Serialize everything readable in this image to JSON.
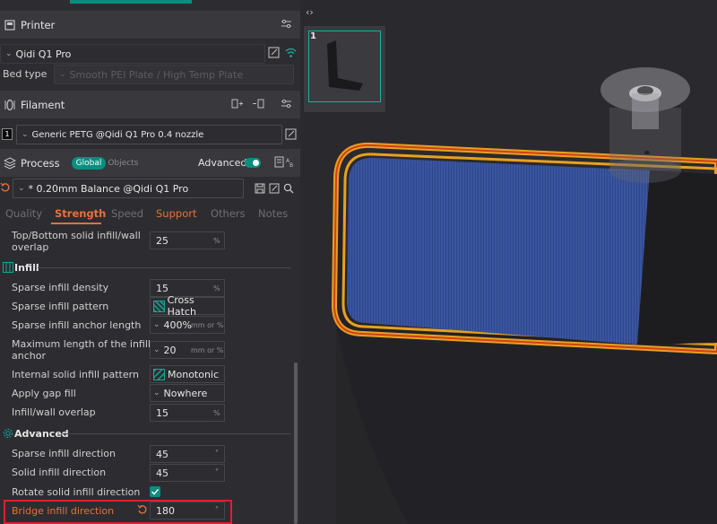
{
  "printer": {
    "title": "Printer",
    "name": "Qidi Q1 Pro",
    "bed_label": "Bed type",
    "bed_value": "Smooth PEI Plate / High Temp Plate"
  },
  "filament": {
    "title": "Filament",
    "slot": "1",
    "name": "Generic PETG @Qidi Q1 Pro 0.4 nozzle"
  },
  "process": {
    "title": "Process",
    "global": "Global",
    "objects": "Objects",
    "advanced_label": "Advanced",
    "preset": "* 0.20mm Balance @Qidi Q1 Pro"
  },
  "tabs": [
    "Quality",
    "Strength",
    "Speed",
    "Support",
    "Others",
    "Notes"
  ],
  "settings": {
    "top_overlap_label_1": "Top/Bottom solid infill/wall",
    "top_overlap_label_2": "overlap",
    "top_overlap_value": "25",
    "infill_title": "Infill",
    "sparse_density_label": "Sparse infill density",
    "sparse_density_value": "15",
    "sparse_pattern_label": "Sparse infill pattern",
    "sparse_pattern_value": "Cross Hatch",
    "anchor_label": "Sparse infill anchor length",
    "anchor_value": "400%",
    "anchor_unit": "mm or %",
    "max_anchor_label_1": "Maximum length of the infill",
    "max_anchor_label_2": "anchor",
    "max_anchor_value": "20",
    "max_anchor_unit": "mm or %",
    "internal_pattern_label": "Internal solid infill pattern",
    "internal_pattern_value": "Monotonic",
    "gap_fill_label": "Apply gap fill",
    "gap_fill_value": "Nowhere",
    "infill_wall_overlap_label": "Infill/wall overlap",
    "infill_wall_overlap_value": "15",
    "advanced_title": "Advanced",
    "sparse_dir_label": "Sparse infill direction",
    "sparse_dir_value": "45",
    "solid_dir_label": "Solid infill direction",
    "solid_dir_value": "45",
    "rotate_label": "Rotate solid infill direction",
    "rotate_checked": true,
    "bridge_dir_label": "Bridge infill direction",
    "bridge_dir_value": "180",
    "pct": "%",
    "deg": "°"
  },
  "plate": {
    "number": "1"
  },
  "colors": {
    "accent": "#0c8d80",
    "tab_active": "#e8703a",
    "highlight": "#e0202a",
    "infill_blue": "#3a55a0"
  }
}
